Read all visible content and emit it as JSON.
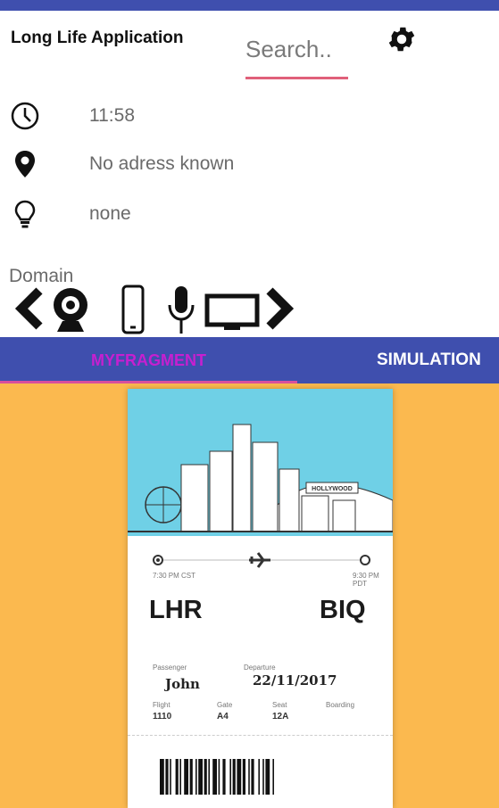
{
  "app": {
    "title": "Long Life Application"
  },
  "search": {
    "placeholder": "Search.."
  },
  "info": {
    "time": "11:58",
    "address": "No adress known",
    "context": "none"
  },
  "domain": {
    "label": "Domain",
    "icons": [
      "chevron-left-icon",
      "webcam-icon",
      "smartphone-icon",
      "microphone-icon",
      "monitor-icon",
      "chevron-right-icon"
    ]
  },
  "tabs": [
    {
      "label": "MYFRAGMENT",
      "active": true
    },
    {
      "label": "SIMULATION",
      "active": false
    }
  ],
  "ticket": {
    "skyline_sign": "HOLLYWOOD",
    "depart_time": "7:30 PM CST",
    "arrive_time": "9:30 PM PDT",
    "origin": "LHR",
    "destination": "BIQ",
    "passenger_label": "Passenger",
    "passenger": "John",
    "departure_label": "Departure",
    "departure": "22/11/2017",
    "flight_label": "Flight",
    "flight": "1110",
    "gate_label": "Gate",
    "gate": "A4",
    "seat_label": "Seat",
    "seat": "12A",
    "boarding_label": "Boarding"
  },
  "colors": {
    "primary": "#3f4fae",
    "accent": "#e0607a",
    "active_tab_text": "#c71fd0",
    "background_panel": "#fbb94f",
    "ticket_sky": "#6fd0e6"
  }
}
